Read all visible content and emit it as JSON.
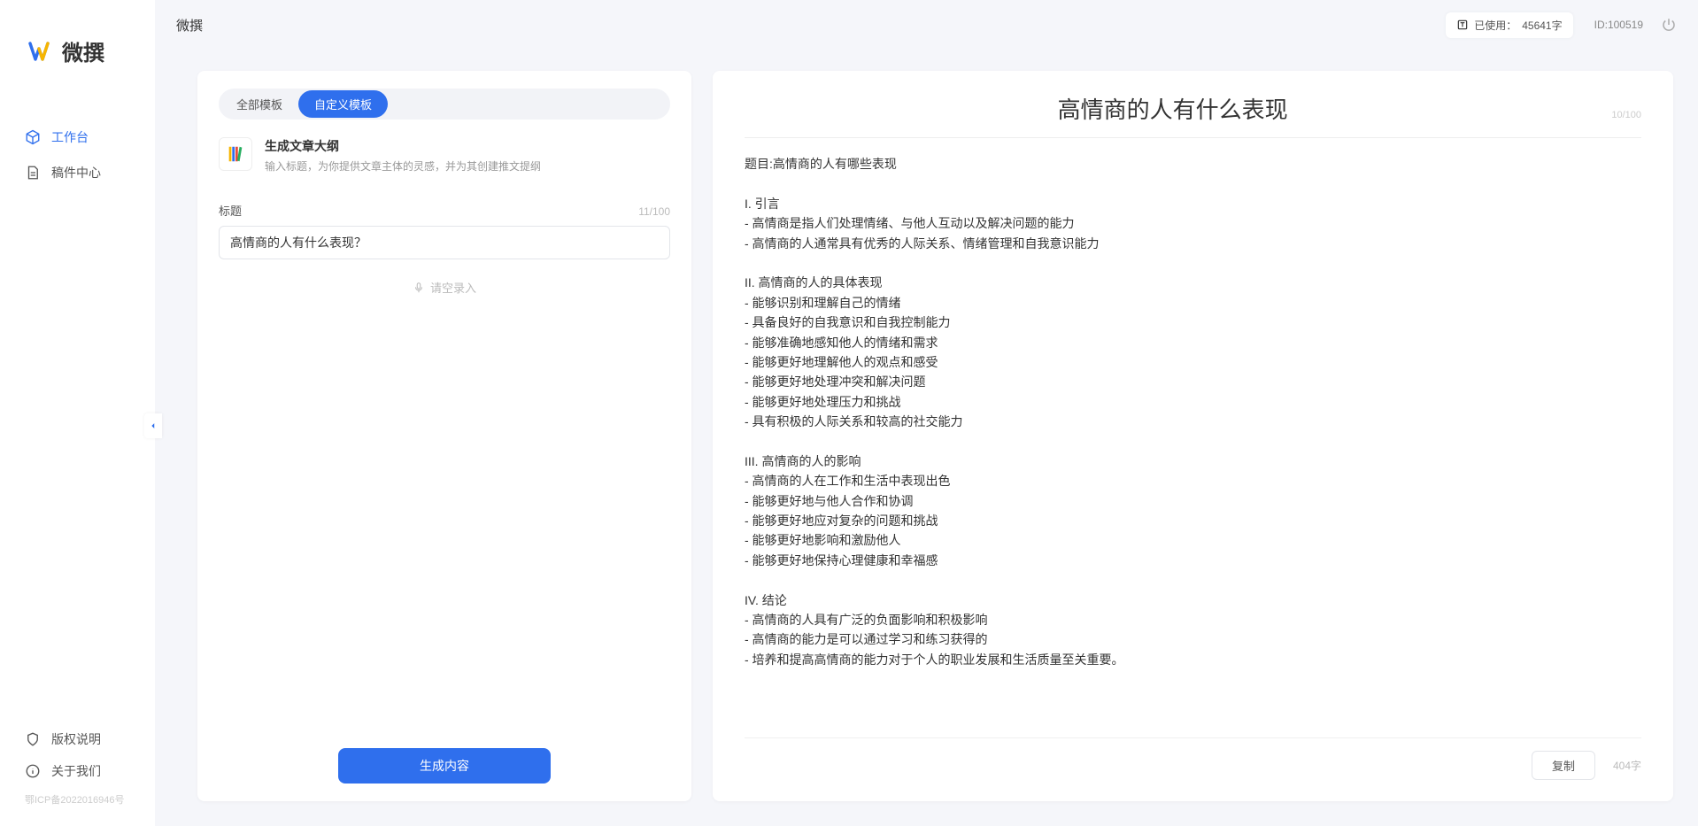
{
  "header": {
    "title": "微撰",
    "usage_prefix": "已使用：",
    "usage_value": "45641字",
    "user_id": "ID:100519"
  },
  "sidebar": {
    "brand": "微撰",
    "nav": [
      {
        "label": "工作台",
        "active": true
      },
      {
        "label": "稿件中心",
        "active": false
      }
    ],
    "bottom": [
      {
        "label": "版权说明"
      },
      {
        "label": "关于我们"
      }
    ],
    "icp": "鄂ICP备2022016946号"
  },
  "left_panel": {
    "tabs": [
      {
        "label": "全部模板",
        "active": false
      },
      {
        "label": "自定义模板",
        "active": true
      }
    ],
    "template": {
      "title": "生成文章大纲",
      "desc": "输入标题，为你提供文章主体的灵感，并为其创建推文提纲",
      "icon": "📝"
    },
    "field": {
      "label": "标题",
      "char_count": "11/100",
      "value": "高情商的人有什么表现？"
    },
    "voice_hint": "请空录入",
    "generate_btn": "生成内容"
  },
  "right_panel": {
    "title": "高情商的人有什么表现",
    "title_count": "10/100",
    "body": "题目:高情商的人有哪些表现\n\nI. 引言\n- 高情商是指人们处理情绪、与他人互动以及解决问题的能力\n- 高情商的人通常具有优秀的人际关系、情绪管理和自我意识能力\n\nII. 高情商的人的具体表现\n- 能够识别和理解自己的情绪\n- 具备良好的自我意识和自我控制能力\n- 能够准确地感知他人的情绪和需求\n- 能够更好地理解他人的观点和感受\n- 能够更好地处理冲突和解决问题\n- 能够更好地处理压力和挑战\n- 具有积极的人际关系和较高的社交能力\n\nIII. 高情商的人的影响\n- 高情商的人在工作和生活中表现出色\n- 能够更好地与他人合作和协调\n- 能够更好地应对复杂的问题和挑战\n- 能够更好地影响和激励他人\n- 能够更好地保持心理健康和幸福感\n\nIV. 结论\n- 高情商的人具有广泛的负面影响和积极影响\n- 高情商的能力是可以通过学习和练习获得的\n- 培养和提高高情商的能力对于个人的职业发展和生活质量至关重要。",
    "copy_btn": "复制",
    "word_count": "404字"
  }
}
